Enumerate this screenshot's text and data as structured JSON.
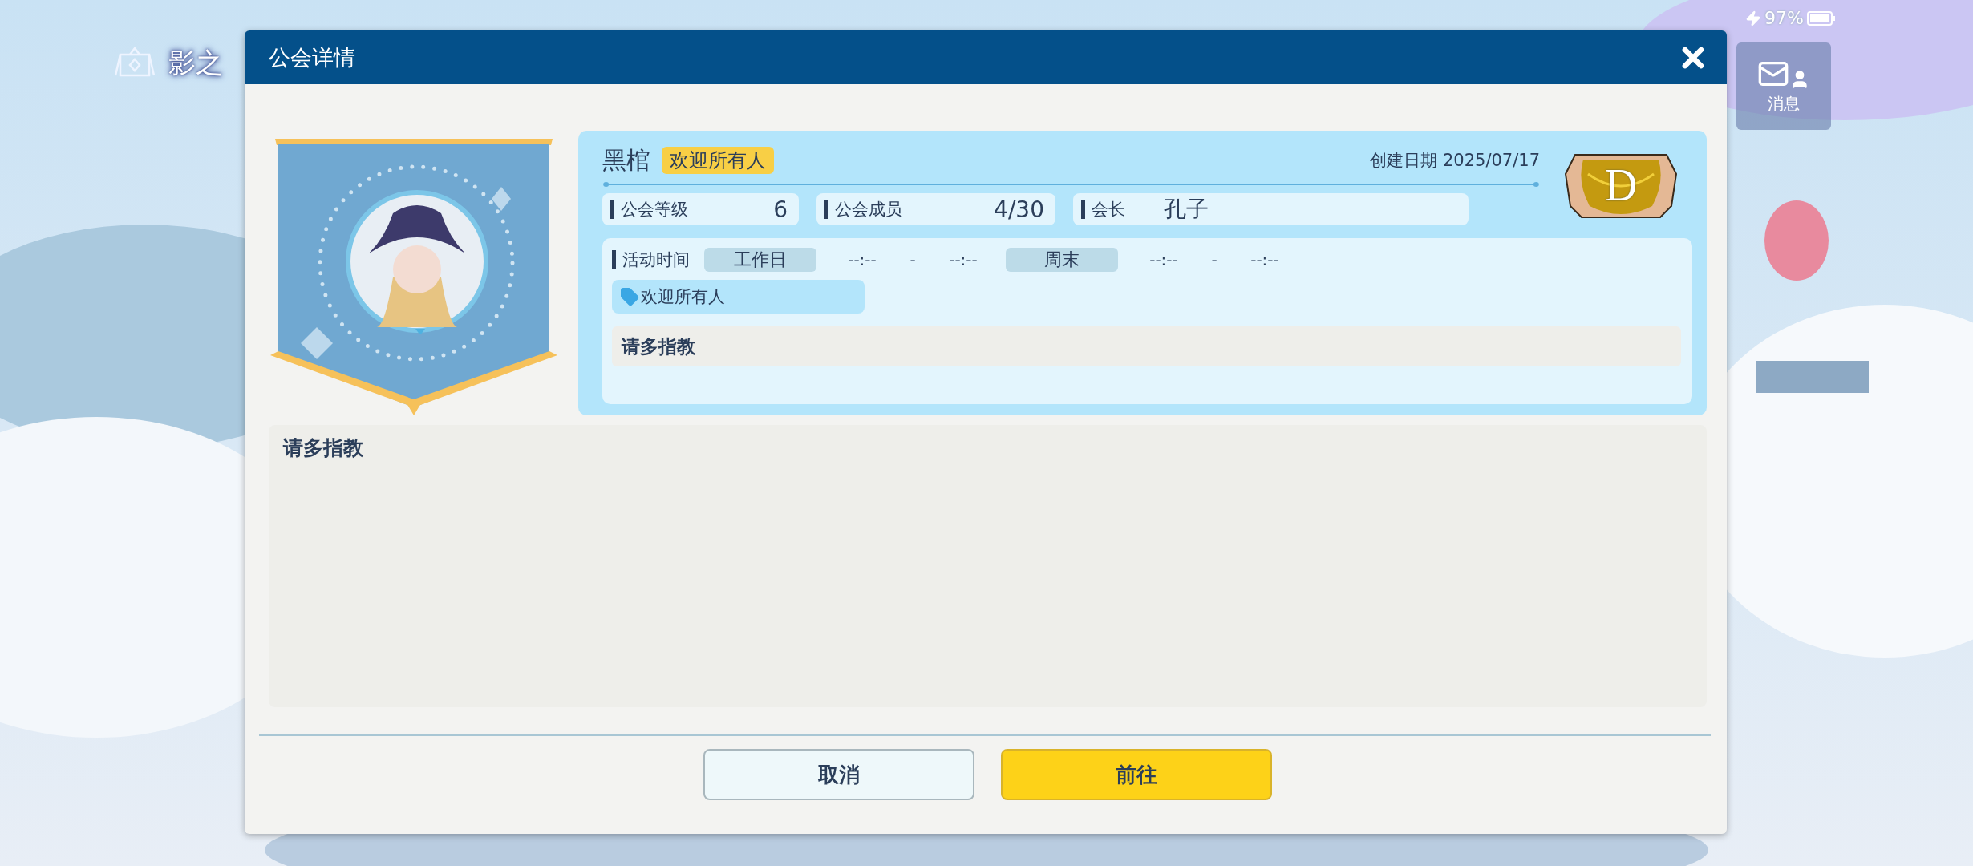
{
  "hud": {
    "title": "影之",
    "battery": "97%",
    "messages_button": "消息"
  },
  "dialog": {
    "title": "公会详情",
    "guild": {
      "name": "黑棺",
      "tag": "欢迎所有人",
      "created_label": "创建日期",
      "created_date": "2025/07/17",
      "rank": "D",
      "stats": [
        {
          "label": "公会等级",
          "value": "6",
          "kind": "number"
        },
        {
          "label": "公会成员",
          "value": "4/30",
          "kind": "number"
        },
        {
          "label": "会长",
          "value": "孔子",
          "kind": "name"
        }
      ],
      "activity": {
        "label": "活动时间",
        "periods": [
          {
            "label": "工作日",
            "start": "--:--",
            "separator": "-",
            "end": "--:--"
          },
          {
            "label": "周末",
            "start": "--:--",
            "separator": "-",
            "end": "--:--"
          }
        ]
      },
      "tags": [
        "欢迎所有人"
      ],
      "motto": "请多指教"
    },
    "description": "请多指教",
    "buttons": [
      {
        "label": "取消",
        "kind": "secondary"
      },
      {
        "label": "前往",
        "kind": "primary"
      }
    ]
  }
}
